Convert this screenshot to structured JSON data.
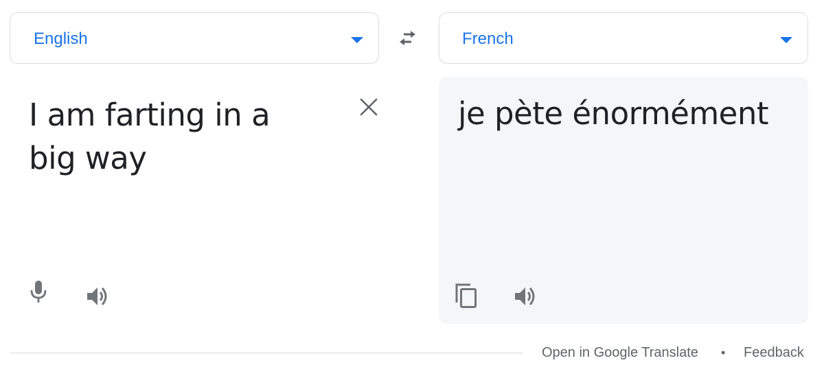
{
  "source_language": {
    "label": "English",
    "text": "I am farting in a big way"
  },
  "target_language": {
    "label": "French",
    "text": "je pète énormément"
  },
  "icons": {
    "swap": "swap-icon",
    "clear": "close-icon",
    "mic": "mic-icon",
    "source_speaker": "speaker-icon",
    "copy": "copy-icon",
    "target_speaker": "speaker-icon"
  },
  "footer": {
    "open_link": "Open in Google Translate",
    "separator": "•",
    "feedback_link": "Feedback"
  },
  "colors": {
    "accent": "#1a73e8",
    "icon": "#70757a",
    "text": "#202124",
    "target_bg": "#f5f6f8"
  }
}
